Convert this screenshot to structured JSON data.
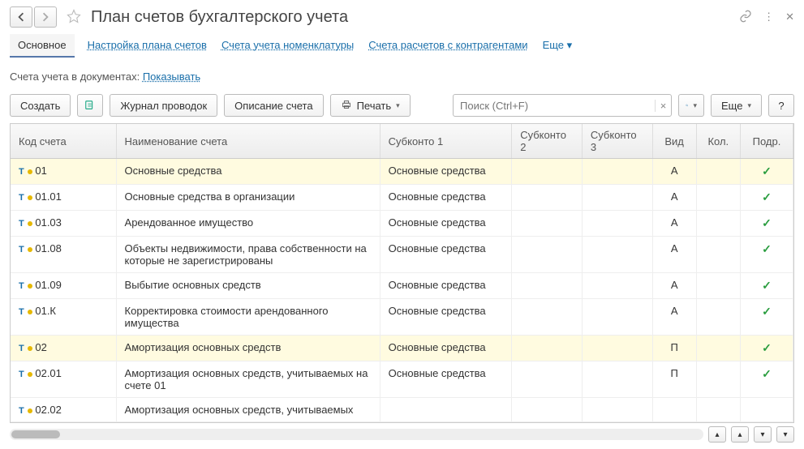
{
  "title": "План счетов бухгалтерского учета",
  "tabs": {
    "main": "Основное",
    "setup": "Настройка плана счетов",
    "items": "Счета учета номенклатуры",
    "contragents": "Счета расчетов с контрагентами",
    "more": "Еще"
  },
  "subline_label": "Счета учета в документах:",
  "subline_link": "Показывать",
  "toolbar": {
    "create": "Создать",
    "journal": "Журнал проводок",
    "describe": "Описание счета",
    "print": "Печать",
    "more": "Еще"
  },
  "search_placeholder": "Поиск (Ctrl+F)",
  "columns": {
    "code": "Код счета",
    "name": "Наименование счета",
    "sub1": "Субконто 1",
    "sub2": "Субконто 2",
    "sub3": "Субконто 3",
    "kind": "Вид",
    "qty": "Кол.",
    "sub": "Подр."
  },
  "rows": [
    {
      "code": "01",
      "name": "Основные средства",
      "sub1": "Основные средства",
      "kind": "А",
      "sub": true,
      "hl": true
    },
    {
      "code": "01.01",
      "name": "Основные средства в организации",
      "sub1": "Основные средства",
      "kind": "А",
      "sub": true
    },
    {
      "code": "01.03",
      "name": "Арендованное имущество",
      "sub1": "Основные средства",
      "kind": "А",
      "sub": true
    },
    {
      "code": "01.08",
      "name": "Объекты недвижимости, права собственности на которые не зарегистрированы",
      "sub1": "Основные средства",
      "kind": "А",
      "sub": true
    },
    {
      "code": "01.09",
      "name": "Выбытие основных средств",
      "sub1": "Основные средства",
      "kind": "А",
      "sub": true
    },
    {
      "code": "01.К",
      "name": "Корректировка стоимости арендованного имущества",
      "sub1": "Основные средства",
      "kind": "А",
      "sub": true
    },
    {
      "code": "02",
      "name": "Амортизация основных средств",
      "sub1": "Основные средства",
      "kind": "П",
      "sub": true,
      "hl": true
    },
    {
      "code": "02.01",
      "name": "Амортизация основных средств, учитываемых на счете 01",
      "sub1": "Основные средства",
      "kind": "П",
      "sub": true
    },
    {
      "code": "02.02",
      "name": "Амортизация основных средств, учитываемых",
      "sub1": "",
      "kind": "",
      "sub": false
    }
  ]
}
